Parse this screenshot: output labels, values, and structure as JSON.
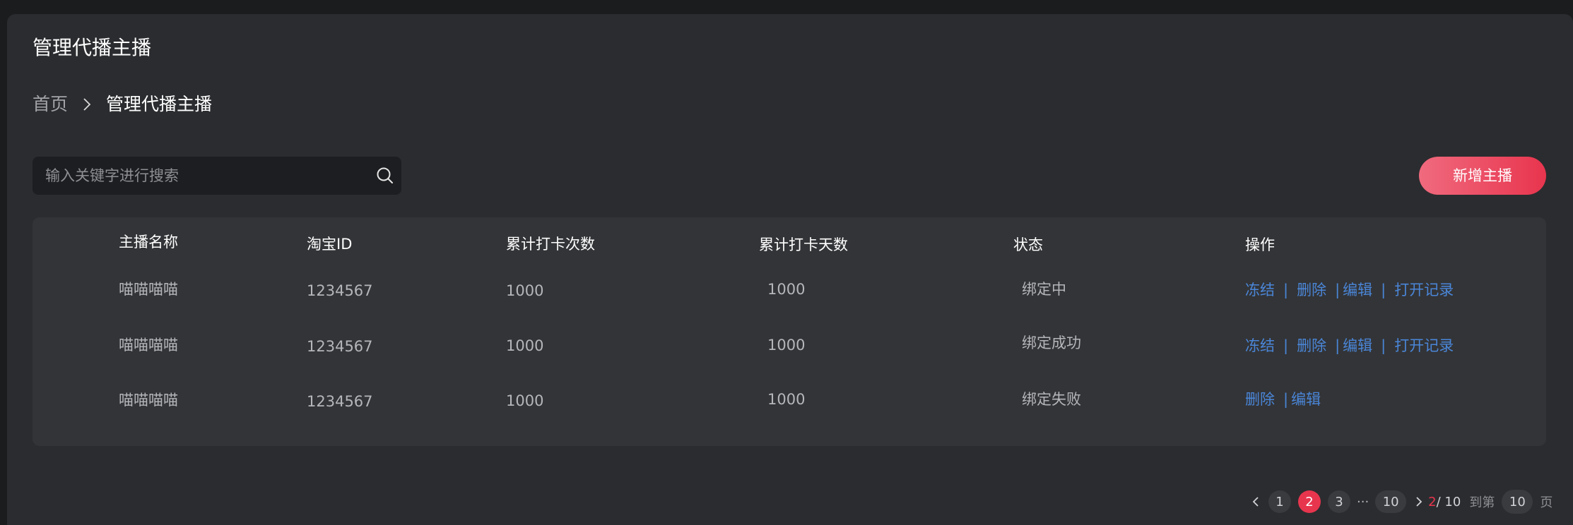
{
  "header": {
    "title": "管理代播主播"
  },
  "breadcrumb": {
    "home": "首页",
    "current": "管理代播主播"
  },
  "search": {
    "placeholder": "输入关键字进行搜索",
    "value": ""
  },
  "toolbar": {
    "add_label": "新增主播"
  },
  "table": {
    "columns": [
      "主播名称",
      "淘宝ID",
      "累计打卡次数",
      "累计打卡天数",
      "状态",
      "操作"
    ],
    "rows": [
      {
        "name": "喵喵喵喵",
        "taobao_id": "1234567",
        "checkin_count": "1000",
        "checkin_days": "1000",
        "status": "绑定中",
        "actions": [
          "冻结",
          "删除",
          "编辑",
          "打开记录"
        ]
      },
      {
        "name": "喵喵喵喵",
        "taobao_id": "1234567",
        "checkin_count": "1000",
        "checkin_days": "1000",
        "status": "绑定成功",
        "actions": [
          "冻结",
          "删除",
          "编辑",
          "打开记录"
        ]
      },
      {
        "name": "喵喵喵喵",
        "taobao_id": "1234567",
        "checkin_count": "1000",
        "checkin_days": "1000",
        "status": "绑定失败",
        "actions": [
          "删除",
          "编辑"
        ]
      }
    ],
    "separator": "|"
  },
  "pagination": {
    "pages": [
      "1",
      "2",
      "3",
      "10"
    ],
    "ellipsis": "···",
    "current": "2",
    "total": "/ 10",
    "goto_label": "到第",
    "goto_value": "10",
    "page_unit": "页"
  },
  "colors": {
    "accent": "#e8354e",
    "link": "#4a86d8",
    "panel": "#2b2c2f",
    "table": "#333437"
  },
  "icons": {
    "search": "search-icon",
    "breadcrumb_separator": "chevron-right-icon",
    "prev": "chevron-left-icon",
    "next": "chevron-right-icon"
  }
}
